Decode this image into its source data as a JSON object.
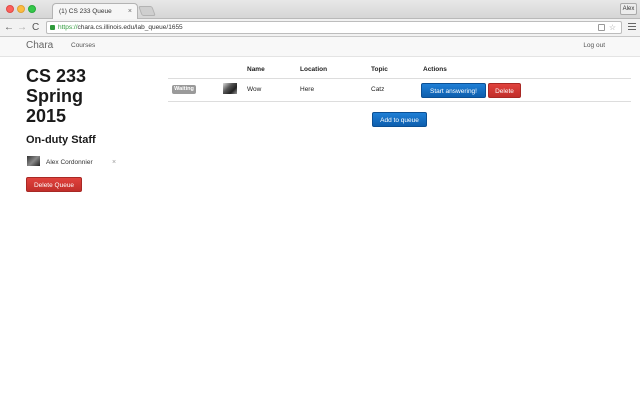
{
  "browser": {
    "tab_title": "(1) CS 233 Queue",
    "tab_close": "×",
    "user_label": "Alex",
    "url_scheme": "https://",
    "url_rest": "chara.cs.illinois.edu/lab_queue/1655",
    "star": "☆",
    "back": "←",
    "forward": "→",
    "reload": "C"
  },
  "appnav": {
    "brand": "Chara",
    "courses": "Courses",
    "logout": "Log out"
  },
  "sidebar": {
    "course_line1": "CS 233",
    "course_line2": "Spring",
    "course_line3": "2015",
    "staff_heading": "On-duty Staff",
    "staff": [
      {
        "name": "Alex Cordonnier",
        "remove": "×"
      }
    ],
    "delete_queue": "Delete Queue"
  },
  "queue": {
    "columns": [
      "Name",
      "Location",
      "Topic",
      "Actions"
    ],
    "rows": [
      {
        "status": "Waiting",
        "name": "Wow",
        "location": "Here",
        "topic": "Catz",
        "start_label": "Start answering!",
        "delete_label": "Delete"
      }
    ],
    "add_label": "Add to queue"
  },
  "colors": {
    "primary": "#1f7fd6",
    "danger": "#d43934",
    "badge": "#9a9a9a"
  }
}
